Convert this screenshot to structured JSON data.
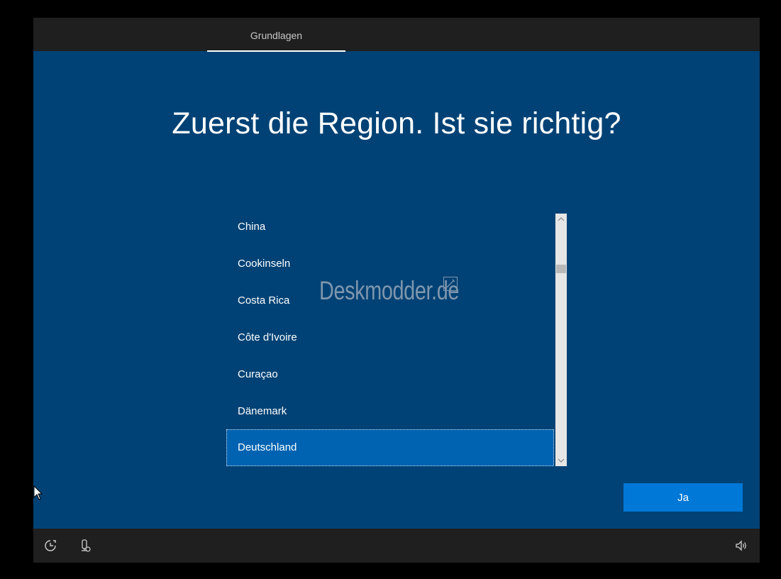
{
  "header": {
    "tab_label": "Grundlagen"
  },
  "main": {
    "heading": "Zuerst die Region. Ist sie richtig?",
    "regions": [
      {
        "label": "China",
        "selected": false
      },
      {
        "label": "Cookinseln",
        "selected": false
      },
      {
        "label": "Costa Rica",
        "selected": false
      },
      {
        "label": "Côte d'Ivoire",
        "selected": false
      },
      {
        "label": "Curaçao",
        "selected": false
      },
      {
        "label": "Dänemark",
        "selected": false
      },
      {
        "label": "Deutschland",
        "selected": true
      }
    ],
    "selected_region": "Deutschland",
    "watermark": "Deskmodder.de",
    "confirm_button": "Ja"
  },
  "footer": {
    "icons": [
      "ease-of-access-icon",
      "microphone-icon",
      "volume-icon"
    ]
  },
  "colors": {
    "background": "#004275",
    "bar": "#1f1f1f",
    "selection": "#0063b1",
    "button": "#0078d7"
  }
}
